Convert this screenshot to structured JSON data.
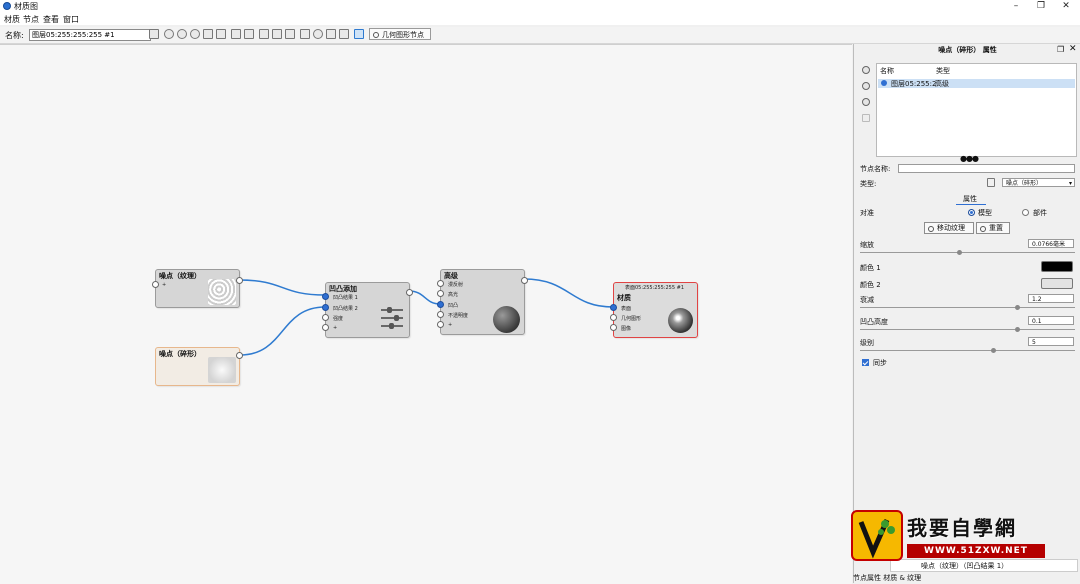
{
  "window": {
    "title": "材质图",
    "controls": [
      "–",
      "❐",
      "✕"
    ]
  },
  "menu": [
    "材质",
    "节点",
    "查看",
    "窗口"
  ],
  "toolbar": {
    "name_label": "名称:",
    "name_value": "图层05:255:255:255 #1",
    "geometry_node_button": "几何图形节点"
  },
  "nodes": {
    "noise_texture": {
      "title": "噪点（纹理）",
      "port": "+"
    },
    "noise_shadow": {
      "title": "噪点（碎形）"
    },
    "bump_add": {
      "title": "凹凸添加",
      "ports": [
        "凹凸结果 1",
        "凹凸结果 2",
        "强度",
        "+"
      ]
    },
    "advanced": {
      "title": "高级",
      "ports": [
        "漫反射",
        "高光",
        "凹凸",
        "不透明度",
        "+"
      ]
    },
    "material": {
      "header": "表面05:255:255:255 #1",
      "title": "材质",
      "ports": [
        "表面",
        "几何图形",
        "图像"
      ]
    }
  },
  "panel": {
    "title": "噪点（碎形） 属性",
    "list_headers": {
      "name": "名称",
      "type": "类型"
    },
    "layer_row": {
      "name": "图层05:255:2",
      "type": "高级"
    },
    "node_name_label": "节点名称:",
    "node_name_value": "",
    "type_label": "类型:",
    "type_value": "噪点（碎形）",
    "section_tab": "属性",
    "projection_label": "对准",
    "radio_model": "模型",
    "radio_part": "部件",
    "move_texture_btn": "移动纹理",
    "reset_btn": "重置",
    "scale_label": "缩放",
    "scale_value": "0.0766毫米",
    "scale_level": 0.46,
    "color1_label": "颜色 1",
    "color1": "#000000",
    "color2_label": "颜色 2",
    "color2": "#e2e2e2",
    "decay_label": "衰减",
    "decay_value": "1.2",
    "decay_level": 0.73,
    "bump_height_label": "凹凸高度",
    "bump_height_value": "0.1",
    "bump_height_level": 0.73,
    "level_label": "级别",
    "level_value": "5",
    "level_level": 0.62,
    "sync_label": "同步",
    "bottom_item": "噪点（纹理）（凹凸结果 1）",
    "status_bar": "节点属性  材质 & 纹理"
  },
  "logo": {
    "text": "我要自學網",
    "url": "WWW.51ZXW.NET"
  },
  "colors": {
    "accent": "#2f6fd2",
    "selected_node_border": "#e04444",
    "shadow_node_border": "#e7b78c"
  }
}
